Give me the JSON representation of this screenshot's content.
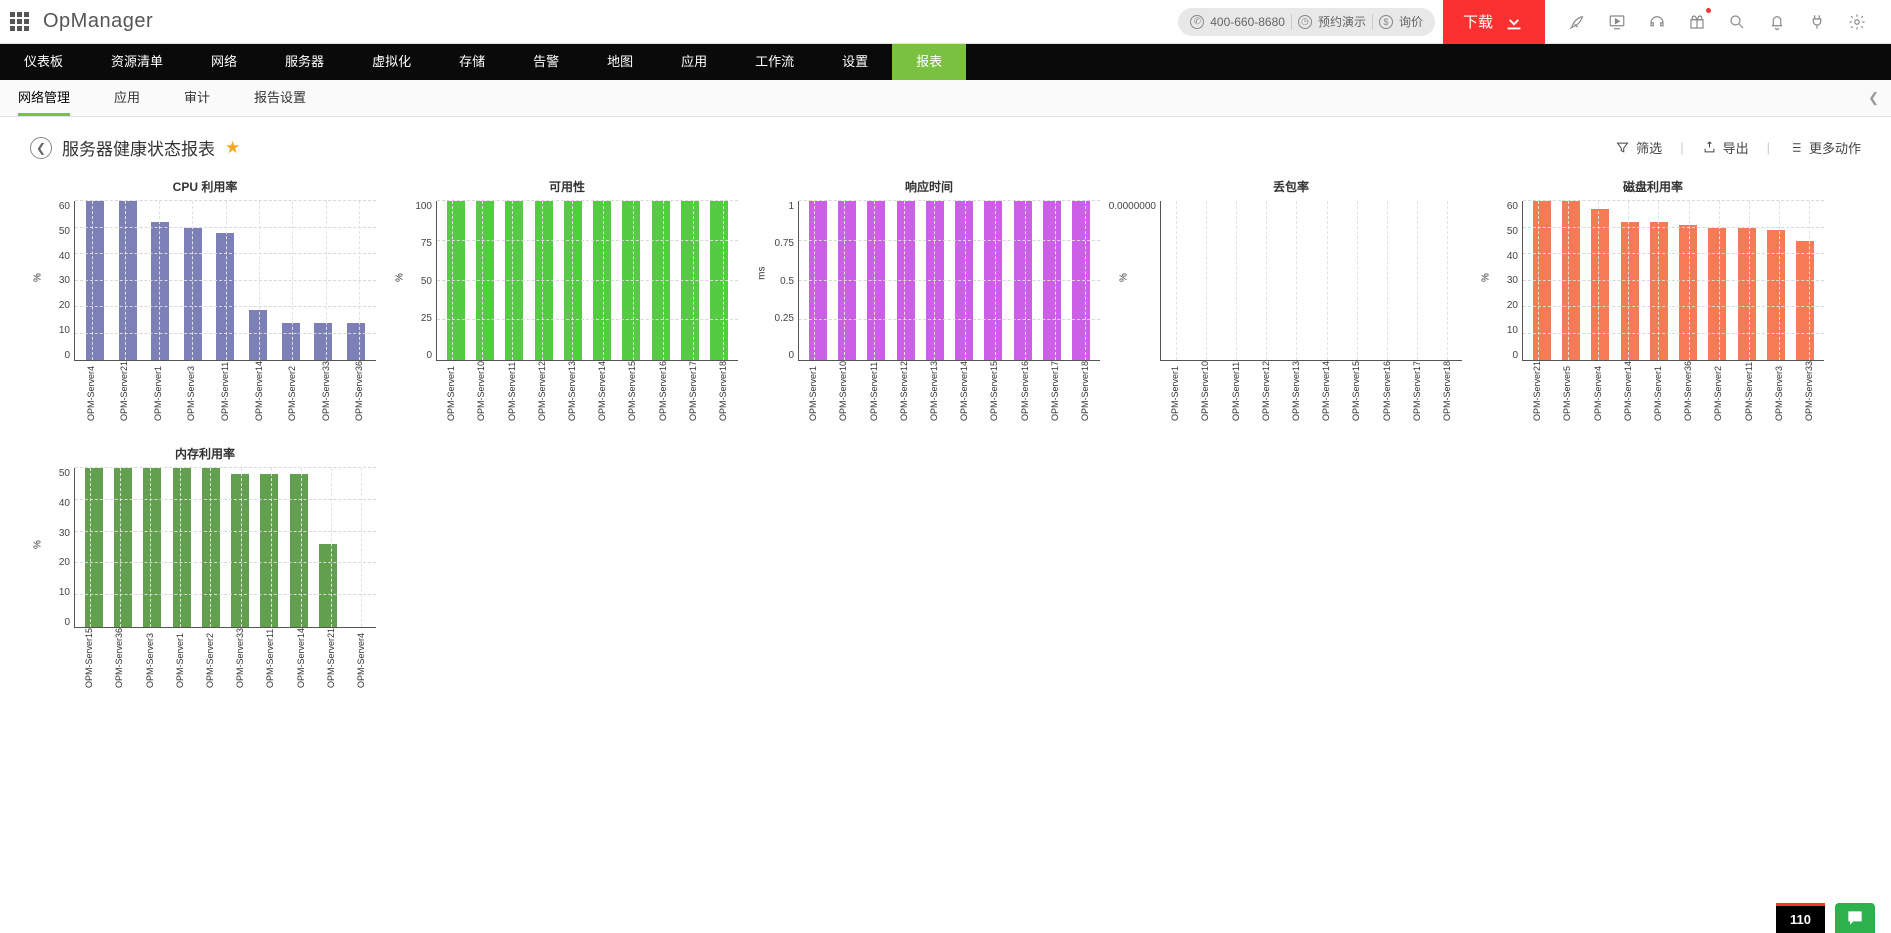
{
  "header": {
    "product": "OpManager",
    "phone": "400-660-8680",
    "demo": "预约演示",
    "quote": "询价",
    "download": "下载"
  },
  "mainnav": [
    "仪表板",
    "资源清单",
    "网络",
    "服务器",
    "虚拟化",
    "存储",
    "告警",
    "地图",
    "应用",
    "工作流",
    "设置",
    "报表"
  ],
  "mainnav_active": 11,
  "subnav": [
    "网络管理",
    "应用",
    "审计",
    "报告设置"
  ],
  "subnav_active": 0,
  "page": {
    "title": "服务器健康状态报表",
    "filter": "筛选",
    "export": "导出",
    "more": "更多动作"
  },
  "bottom": {
    "count": "110"
  },
  "chart_data": [
    {
      "type": "bar",
      "title": "CPU 利用率",
      "ylabel": "%",
      "color": "#7d80b7",
      "ylim": [
        0,
        60
      ],
      "yticks": [
        0,
        10,
        20,
        30,
        40,
        50,
        60
      ],
      "categories": [
        "OPM-Server4",
        "OPM-Server21",
        "OPM-Server1",
        "OPM-Server3",
        "OPM-Server11",
        "OPM-Server14",
        "OPM-Server2",
        "OPM-Server33",
        "OPM-Server36"
      ],
      "values": [
        60,
        60,
        52,
        50,
        48,
        19,
        14,
        14,
        14
      ]
    },
    {
      "type": "bar",
      "title": "可用性",
      "ylabel": "%",
      "color": "#54cb43",
      "ylim": [
        0,
        100
      ],
      "yticks": [
        0,
        25,
        50,
        75,
        100
      ],
      "categories": [
        "OPM-Server1",
        "OPM-Server10",
        "OPM-Server11",
        "OPM-Server12",
        "OPM-Server13",
        "OPM-Server14",
        "OPM-Server15",
        "OPM-Server16",
        "OPM-Server17",
        "OPM-Server18"
      ],
      "values": [
        100,
        100,
        100,
        100,
        100,
        100,
        100,
        100,
        100,
        100
      ]
    },
    {
      "type": "bar",
      "title": "响应时间",
      "ylabel": "ms",
      "color": "#cc5ee8",
      "ylim": [
        0,
        1.0
      ],
      "yticks": [
        0.0,
        0.25,
        0.5,
        0.75,
        1.0
      ],
      "categories": [
        "OPM-Server1",
        "OPM-Server10",
        "OPM-Server11",
        "OPM-Server12",
        "OPM-Server13",
        "OPM-Server14",
        "OPM-Server15",
        "OPM-Server16",
        "OPM-Server17",
        "OPM-Server18"
      ],
      "values": [
        1.0,
        1.0,
        1.0,
        1.0,
        1.0,
        1.0,
        1.0,
        1.0,
        1.0,
        1.0
      ]
    },
    {
      "type": "bar",
      "title": "丢包率",
      "ylabel": "%",
      "color": "#999",
      "ylim": [
        0,
        1
      ],
      "yticks": [
        "0.0000000"
      ],
      "categories": [
        "OPM-Server1",
        "OPM-Server10",
        "OPM-Server11",
        "OPM-Server12",
        "OPM-Server13",
        "OPM-Server14",
        "OPM-Server15",
        "OPM-Server16",
        "OPM-Server17",
        "OPM-Server18"
      ],
      "values": [
        0,
        0,
        0,
        0,
        0,
        0,
        0,
        0,
        0,
        0
      ]
    },
    {
      "type": "bar",
      "title": "磁盘利用率",
      "ylabel": "%",
      "color": "#f47b55",
      "ylim": [
        0,
        60
      ],
      "yticks": [
        0,
        10,
        20,
        30,
        40,
        50,
        60
      ],
      "categories": [
        "OPM-Server21",
        "OPM-Server5",
        "OPM-Server4",
        "OPM-Server14",
        "OPM-Server1",
        "OPM-Server36",
        "OPM-Server2",
        "OPM-Server11",
        "OPM-Server3",
        "OPM-Server33"
      ],
      "values": [
        62,
        60,
        57,
        52,
        52,
        51,
        50,
        50,
        49,
        45
      ]
    },
    {
      "type": "bar",
      "title": "内存利用率",
      "ylabel": "%",
      "color": "#629f4f",
      "ylim": [
        0,
        50
      ],
      "yticks": [
        0,
        10,
        20,
        30,
        40,
        50
      ],
      "categories": [
        "OPM-Server15",
        "OPM-Server36",
        "OPM-Server3",
        "OPM-Server1",
        "OPM-Server2",
        "OPM-Server33",
        "OPM-Server11",
        "OPM-Server14",
        "OPM-Server21",
        "OPM-Server4"
      ],
      "values": [
        52,
        51,
        51,
        51,
        50,
        48,
        48,
        48,
        26,
        0
      ]
    }
  ]
}
